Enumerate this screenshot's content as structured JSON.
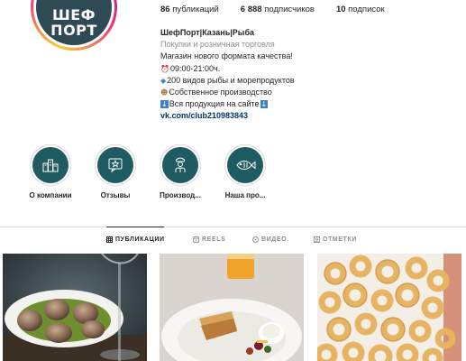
{
  "profile": {
    "avatar_logo_line1": "ШЕФ",
    "avatar_logo_line2": "ПОРТ",
    "stats": {
      "posts": {
        "value": "86",
        "label": "публикаций"
      },
      "followers": {
        "value": "6 888",
        "label": "подписчиков"
      },
      "following": {
        "value": "10",
        "label": "подписок"
      }
    },
    "bio": {
      "name": "ШефПорт|Казань|Рыба",
      "category": "Покупки и розничная торговля",
      "line1": "Магазин нового формата качества!",
      "line2": "09:00-21:00ч.",
      "line3": "200 видов рыбы и морепродуктов",
      "line4": "Собственное производство",
      "line5": "Вся продукция на сайте",
      "link": "vk.com/club210983843"
    }
  },
  "highlights": [
    {
      "label": "О компании",
      "icon": "buildings-icon"
    },
    {
      "label": "Отзывы",
      "icon": "review-star-icon"
    },
    {
      "label": "Производ...",
      "icon": "chef-icon"
    },
    {
      "label": "Наша про...",
      "icon": "fish-icon"
    }
  ],
  "tabs": [
    {
      "label": "ПУБЛИКАЦИИ",
      "icon": "grid-icon",
      "active": true
    },
    {
      "label": "REELS",
      "icon": "reels-icon",
      "active": false
    },
    {
      "label": "ВИДЕО",
      "icon": "video-icon",
      "active": false
    },
    {
      "label": "ОТМЕТКИ",
      "icon": "tag-icon",
      "active": false
    }
  ],
  "posts": [
    {
      "subject": "escargots-plate-photo"
    },
    {
      "subject": "pastry-dish-photo"
    },
    {
      "subject": "fried-calamari-rings-photo"
    }
  ],
  "colors": {
    "highlight_bg": "#1f5b62",
    "avatar_bg": "#2f4a55",
    "link": "#00376b",
    "muted": "#8e8e8e"
  }
}
